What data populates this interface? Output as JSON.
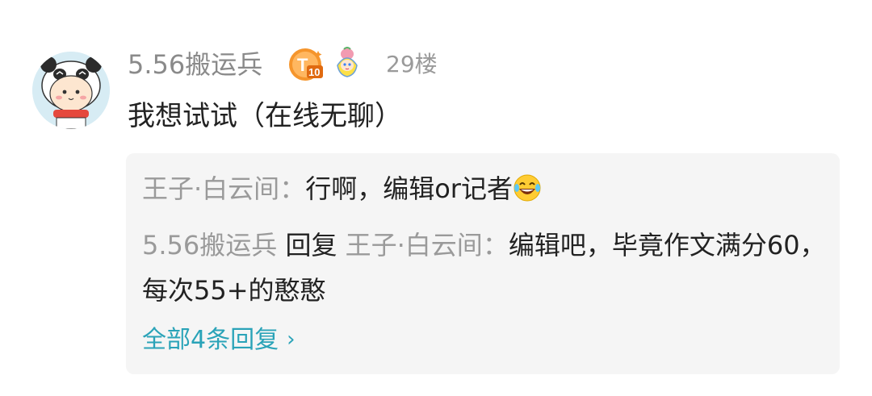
{
  "comment": {
    "username": "5.56搬运兵",
    "badges": [
      "t10-badge",
      "fruit-fairy-badge"
    ],
    "floor": "29楼",
    "text": "我想试试（在线无聊）"
  },
  "replies": [
    {
      "author": "王子·白云间",
      "separator": "：",
      "text": "行啊，编辑or记者",
      "emoji": "laughing-tears-emoji"
    },
    {
      "author": "5.56搬运兵",
      "reply_word": "回复",
      "target": "王子·白云间",
      "separator": "：",
      "text": "编辑吧，毕竟作文满分60，每次55+的憨憨"
    }
  ],
  "view_all": {
    "label": "全部4条回复",
    "icon": "chevron-right-icon"
  },
  "colors": {
    "username": "#8a8a8a",
    "body_text": "#222222",
    "reply_bg": "#f5f5f5",
    "link": "#2aa3b8",
    "badge_orange": "#f5952c"
  }
}
